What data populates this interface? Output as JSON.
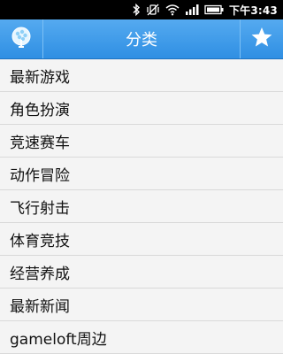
{
  "status": {
    "time": "下午3:43"
  },
  "header": {
    "title": "分类"
  },
  "categories": [
    "最新游戏",
    "角色扮演",
    "竞速赛车",
    "动作冒险",
    "飞行射击",
    "体育竞技",
    "经营养成",
    "最新新闻",
    "gameloft周边"
  ]
}
